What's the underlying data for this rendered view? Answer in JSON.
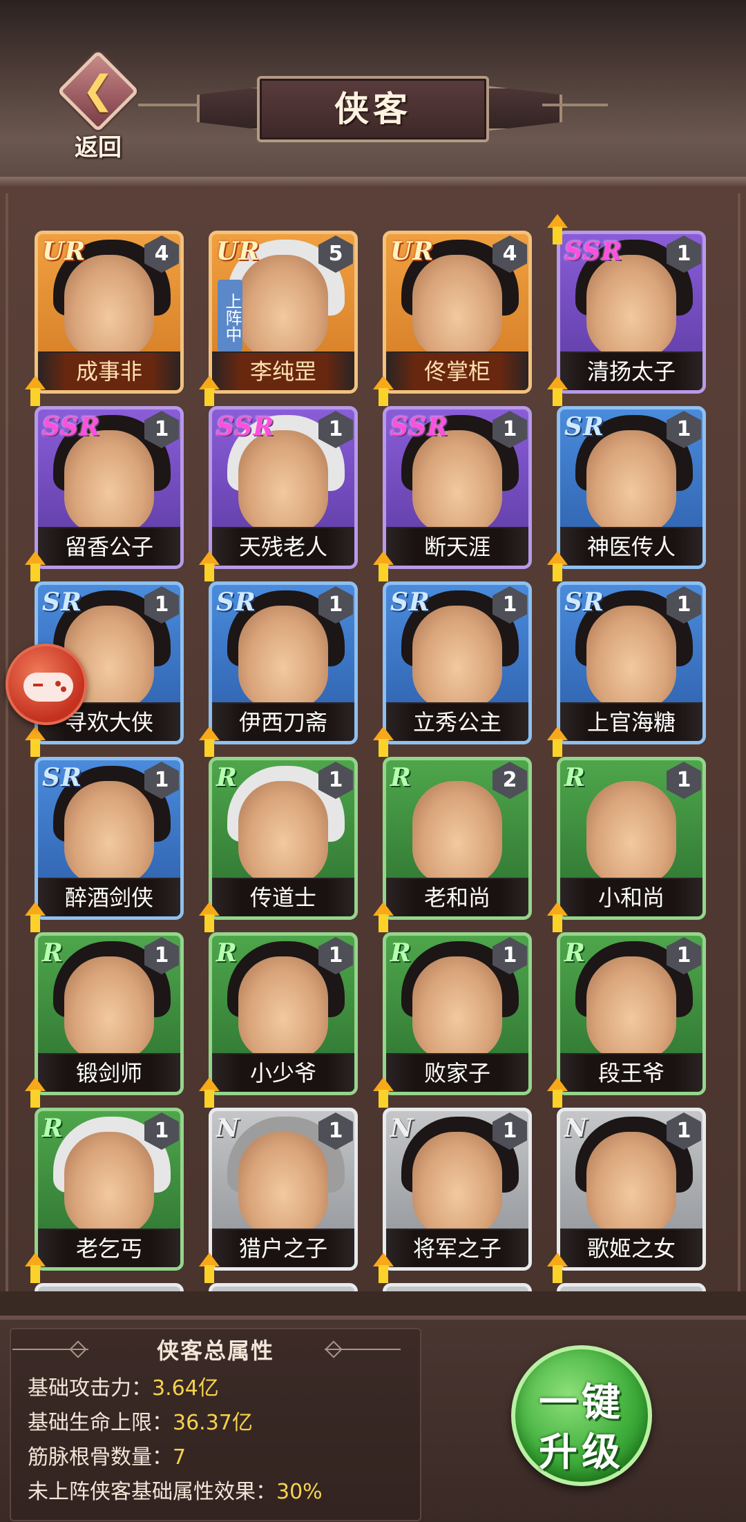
{
  "header": {
    "title": "侠客",
    "back_label": "返回"
  },
  "deployed_tag": "上阵中",
  "heroes": [
    {
      "name": "成事非",
      "rarity": "UR",
      "count": "4"
    },
    {
      "name": "李纯罡",
      "rarity": "UR",
      "count": "5",
      "deployed": true
    },
    {
      "name": "佟掌柜",
      "rarity": "UR",
      "count": "4"
    },
    {
      "name": "清扬太子",
      "rarity": "SSR",
      "count": "1"
    },
    {
      "name": "留香公子",
      "rarity": "SSR",
      "count": "1"
    },
    {
      "name": "天残老人",
      "rarity": "SSR",
      "count": "1"
    },
    {
      "name": "断天涯",
      "rarity": "SSR",
      "count": "1"
    },
    {
      "name": "神医传人",
      "rarity": "SR",
      "count": "1"
    },
    {
      "name": "寻欢大侠",
      "rarity": "SR",
      "count": "1"
    },
    {
      "name": "伊西刀斋",
      "rarity": "SR",
      "count": "1"
    },
    {
      "name": "立秀公主",
      "rarity": "SR",
      "count": "1"
    },
    {
      "name": "上官海糖",
      "rarity": "SR",
      "count": "1"
    },
    {
      "name": "醉酒剑侠",
      "rarity": "SR",
      "count": "1"
    },
    {
      "name": "传道士",
      "rarity": "R",
      "count": "1"
    },
    {
      "name": "老和尚",
      "rarity": "R",
      "count": "2"
    },
    {
      "name": "小和尚",
      "rarity": "R",
      "count": "1"
    },
    {
      "name": "锻剑师",
      "rarity": "R",
      "count": "1"
    },
    {
      "name": "小少爷",
      "rarity": "R",
      "count": "1"
    },
    {
      "name": "败家子",
      "rarity": "R",
      "count": "1"
    },
    {
      "name": "段王爷",
      "rarity": "R",
      "count": "1"
    },
    {
      "name": "老乞丐",
      "rarity": "R",
      "count": "1"
    },
    {
      "name": "猎户之子",
      "rarity": "N",
      "count": "1"
    },
    {
      "name": "将军之子",
      "rarity": "N",
      "count": "1"
    },
    {
      "name": "歌姬之女",
      "rarity": "N",
      "count": "1"
    }
  ],
  "stats": {
    "title": "侠客总属性",
    "rows": [
      {
        "label": "基础攻击力：",
        "value": "3.64亿"
      },
      {
        "label": "基础生命上限：",
        "value": "36.37亿"
      },
      {
        "label": "筋脉根骨数量：",
        "value": "7"
      },
      {
        "label": "未上阵侠客基础属性效果：",
        "value": "30%"
      }
    ]
  },
  "upgrade_button": {
    "line1": "一键",
    "line2": "升级"
  },
  "icons": {
    "back": "chevron-left-icon",
    "upgrade_arrow": "up-arrow-icon",
    "floating": "gamepad-icon"
  },
  "colors": {
    "ur": "#d27a25",
    "ssr": "#5a3aa0",
    "sr": "#2c5da8",
    "r": "#2c7030",
    "n": "#8d9095",
    "upgrade": "#3fae3b",
    "stat_value": "#f7d24f"
  }
}
